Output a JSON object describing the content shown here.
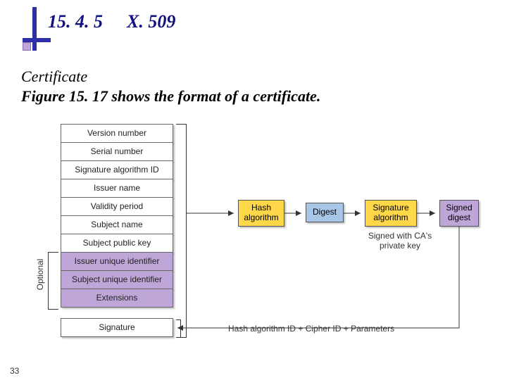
{
  "header": {
    "section_number": "15. 4. 5",
    "section_title": "X. 509"
  },
  "body": {
    "subtitle": "Certificate",
    "sentence": "Figure 15. 17 shows the format of a certificate."
  },
  "diagram": {
    "fields": [
      {
        "label": "Version number",
        "shaded": false
      },
      {
        "label": "Serial number",
        "shaded": false
      },
      {
        "label": "Signature algorithm ID",
        "shaded": false
      },
      {
        "label": "Issuer name",
        "shaded": false
      },
      {
        "label": "Validity period",
        "shaded": false
      },
      {
        "label": "Subject name",
        "shaded": false
      },
      {
        "label": "Subject public key",
        "shaded": false
      },
      {
        "label": "Issuer unique identifier",
        "shaded": true
      },
      {
        "label": "Subject unique identifier",
        "shaded": true
      },
      {
        "label": "Extensions",
        "shaded": true
      }
    ],
    "signature_field": "Signature",
    "optional_label": "Optional",
    "flow": {
      "hash": "Hash\nalgorithm",
      "digest": "Digest",
      "sigalg": "Signature\nalgorithm",
      "sdig": "Signed\ndigest"
    },
    "captions": {
      "ca": "Signed with CA's\nprivate key",
      "bottom": "Hash algorithm ID + Cipher ID + Parameters"
    }
  },
  "page_number": "33"
}
